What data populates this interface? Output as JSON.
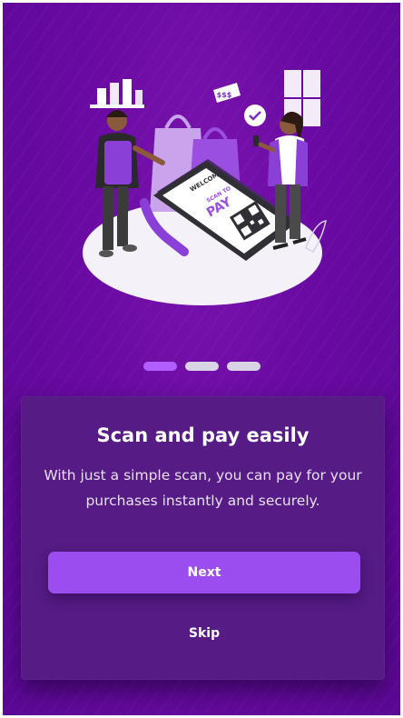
{
  "onboarding": {
    "title": "Scan and pay easily",
    "description": "With just a simple scan, you can pay for your purchases instantly and securely.",
    "next_label": "Next",
    "skip_label": "Skip",
    "pagination": {
      "total": 3,
      "current": 1
    }
  },
  "illustration": {
    "terminal_welcome": "WELCOME",
    "terminal_scan_to": "SCAN TO",
    "terminal_pay": "PAY",
    "price_tag": "$$$"
  },
  "colors": {
    "background": "#6a0aa3",
    "card": "#561b85",
    "accent": "#9b4df0",
    "dot_active": "#b160ff",
    "dot_inactive": "#d9d3e6"
  }
}
